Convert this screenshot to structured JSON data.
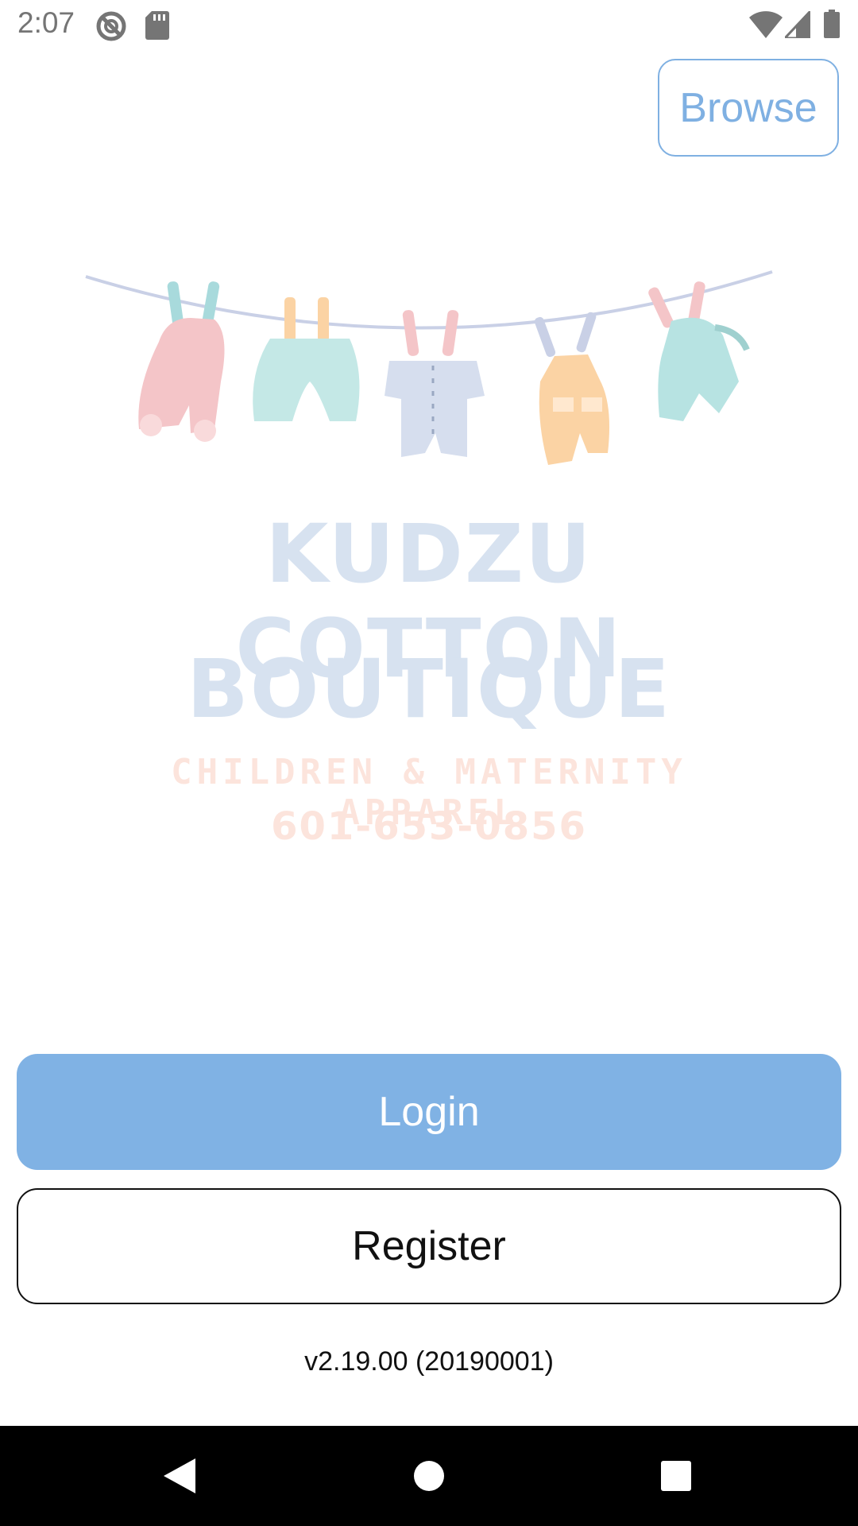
{
  "status_bar": {
    "time": "2:07",
    "icons": [
      "do-not-disturb-icon",
      "sd-card-icon",
      "wifi-icon",
      "signal-icon",
      "battery-icon"
    ]
  },
  "header": {
    "browse_label": "Browse"
  },
  "logo": {
    "line1": "KUDZU COTTON",
    "line2": "BOUTIQUE",
    "tagline": "CHILDREN & MATERNITY APPAREL",
    "phone": "601-653-0856"
  },
  "actions": {
    "login_label": "Login",
    "register_label": "Register"
  },
  "footer": {
    "version": "v2.19.00 (20190001)"
  },
  "nav_bar": {
    "buttons": [
      "back-icon",
      "home-icon",
      "recents-icon"
    ]
  },
  "colors": {
    "accent": "#80b2e4",
    "browse_text": "#7fb0e2",
    "logo_title": "#d7e2f0",
    "logo_tagline": "#fce4dc"
  }
}
